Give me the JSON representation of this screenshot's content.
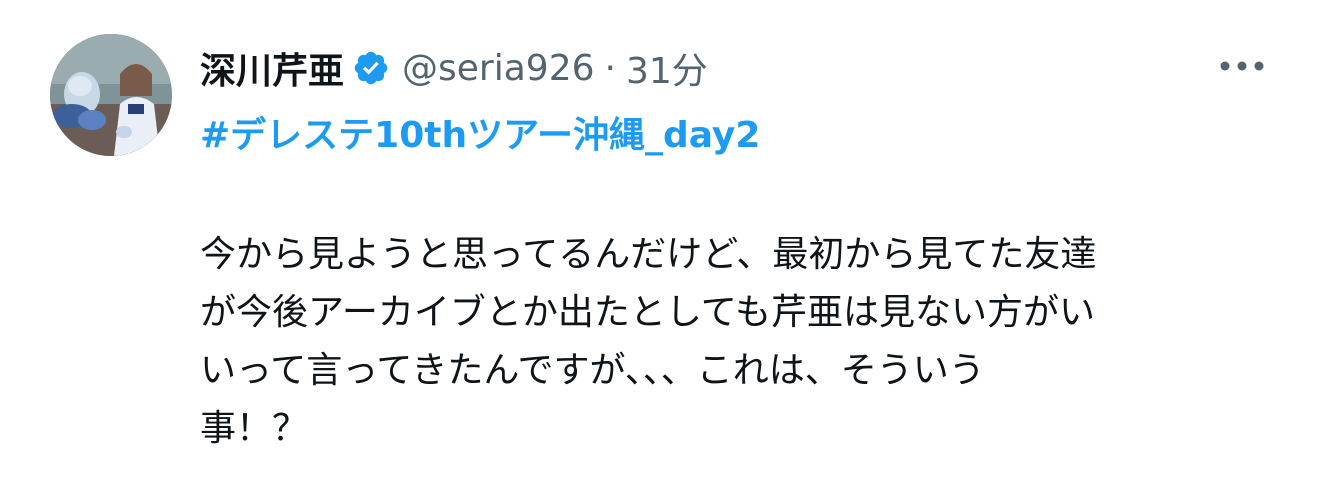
{
  "author": {
    "display_name": "深川芹亜",
    "handle": "@seria926",
    "separator": "·",
    "time": "31分",
    "verified": true,
    "avatar_icon": "profile-photo"
  },
  "menu": {
    "more_icon": "more-horizontal-icon"
  },
  "tweet": {
    "hashtag": "#デレステ10thツアー沖縄_day2",
    "lines": [
      "今から見ようと思ってるんだけど、最初から見てた友達",
      "が今後アーカイブとか出たとしても芹亜は見ない方がい",
      "いって言ってきたんですが、、、これは、そういう",
      "事！？"
    ]
  },
  "colors": {
    "accent": "#1d9bf0",
    "text": "#0f1419",
    "secondary": "#536471"
  }
}
